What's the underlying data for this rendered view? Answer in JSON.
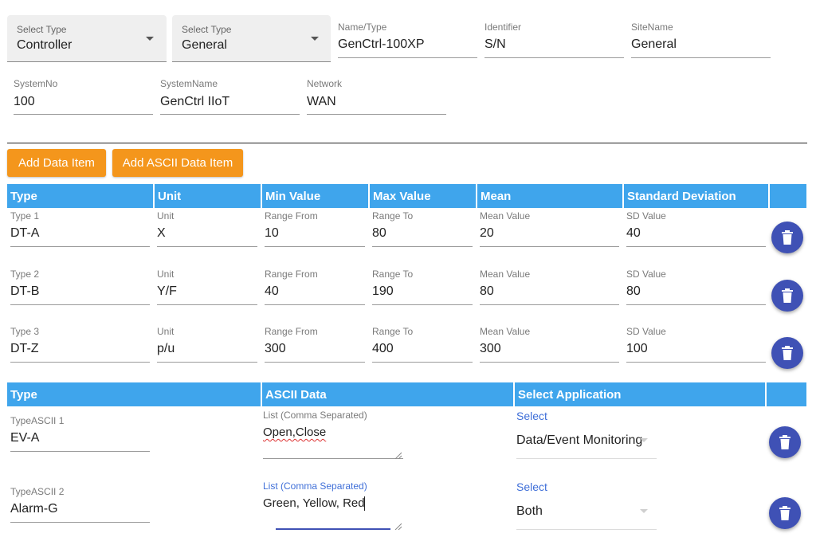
{
  "top": {
    "select_type_1": {
      "label": "Select Type",
      "value": "Controller"
    },
    "select_type_2": {
      "label": "Select Type",
      "value": "General"
    },
    "name_type": {
      "label": "Name/Type",
      "value": "GenCtrl-100XP"
    },
    "identifier": {
      "label": "Identifier",
      "value": "S/N"
    },
    "site_name": {
      "label": "SiteName",
      "value": "General"
    },
    "system_no": {
      "label": "SystemNo",
      "value": "100"
    },
    "system_name": {
      "label": "SystemName",
      "value": "GenCtrl IIoT"
    },
    "network": {
      "label": "Network",
      "value": "WAN"
    }
  },
  "buttons": {
    "add_data_item": "Add Data Item",
    "add_ascii_data_item": "Add ASCII Data Item"
  },
  "data_table": {
    "headers": [
      "Type",
      "Unit",
      "Min Value",
      "Max Value",
      "Mean",
      "Standard Deviation"
    ],
    "rows": [
      {
        "type_label": "Type 1",
        "type": "DT-A",
        "unit_label": "Unit",
        "unit": "X",
        "min_label": "Range From",
        "min": "10",
        "max_label": "Range To",
        "max": "80",
        "mean_label": "Mean Value",
        "mean": "20",
        "sd_label": "SD Value",
        "sd": "40"
      },
      {
        "type_label": "Type 2",
        "type": "DT-B",
        "unit_label": "Unit",
        "unit": "Y/F",
        "min_label": "Range From",
        "min": "40",
        "max_label": "Range To",
        "max": "190",
        "mean_label": "Mean Value",
        "mean": "80",
        "sd_label": "SD Value",
        "sd": "80"
      },
      {
        "type_label": "Type 3",
        "type": "DT-Z",
        "unit_label": "Unit",
        "unit": "p/u",
        "min_label": "Range From",
        "min": "300",
        "max_label": "Range To",
        "max": "400",
        "mean_label": "Mean Value",
        "mean": "300",
        "sd_label": "SD Value",
        "sd": "100"
      }
    ]
  },
  "ascii_table": {
    "headers": [
      "Type",
      "ASCII Data",
      "Select Application"
    ],
    "rows": [
      {
        "type_label": "TypeASCII 1",
        "type": "EV-A",
        "data_label": "List (Comma Separated)",
        "data": "Open,Close",
        "app_label": "Select",
        "app": "Data/Event Monitoring"
      },
      {
        "type_label": "TypeASCII 2",
        "type": "Alarm-G",
        "data_label": "List (Comma Separated)",
        "data": "Green, Yellow, Red",
        "app_label": "Select",
        "app": "Both"
      }
    ]
  },
  "colors": {
    "header_bg": "#3fa5ec",
    "button_bg": "#f4961c",
    "delete_bg": "#3f51b5",
    "accent_blue": "#3f6fd8"
  },
  "icons": {
    "delete": "trash-icon",
    "dropdown": "caret-down-icon",
    "resize": "resize-grip-icon"
  }
}
